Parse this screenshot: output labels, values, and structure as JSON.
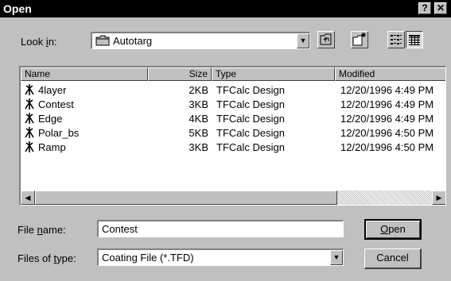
{
  "window": {
    "title": "Open",
    "help_label": "?",
    "close_label": "✕"
  },
  "lookin": {
    "label_pre": "Look ",
    "label_u": "i",
    "label_post": "n:",
    "value": "Autotarg"
  },
  "columns": [
    "Name",
    "Size",
    "Type",
    "Modified"
  ],
  "files": [
    {
      "name": "4layer",
      "size": "2KB",
      "type": "TFCalc Design",
      "modified": "12/20/1996 4:49 PM"
    },
    {
      "name": "Contest",
      "size": "3KB",
      "type": "TFCalc Design",
      "modified": "12/20/1996 4:49 PM"
    },
    {
      "name": "Edge",
      "size": "4KB",
      "type": "TFCalc Design",
      "modified": "12/20/1996 4:49 PM"
    },
    {
      "name": "Polar_bs",
      "size": "5KB",
      "type": "TFCalc Design",
      "modified": "12/20/1996 4:50 PM"
    },
    {
      "name": "Ramp",
      "size": "3KB",
      "type": "TFCalc Design",
      "modified": "12/20/1996 4:50 PM"
    }
  ],
  "filename": {
    "label_pre": "File ",
    "label_u": "n",
    "label_post": "ame:",
    "value": "Contest"
  },
  "filetype": {
    "label_pre": "Files of ",
    "label_u": "t",
    "label_post": "ype:",
    "value": "Coating File (*.TFD)"
  },
  "buttons": {
    "open_u": "O",
    "open_rest": "pen",
    "cancel": "Cancel"
  },
  "icons": {
    "folder": "folder-icon",
    "up": "up-one-level-icon",
    "newfolder": "new-folder-icon",
    "list": "list-view-icon",
    "details": "details-view-icon",
    "file": "tfcalc-design-icon"
  }
}
